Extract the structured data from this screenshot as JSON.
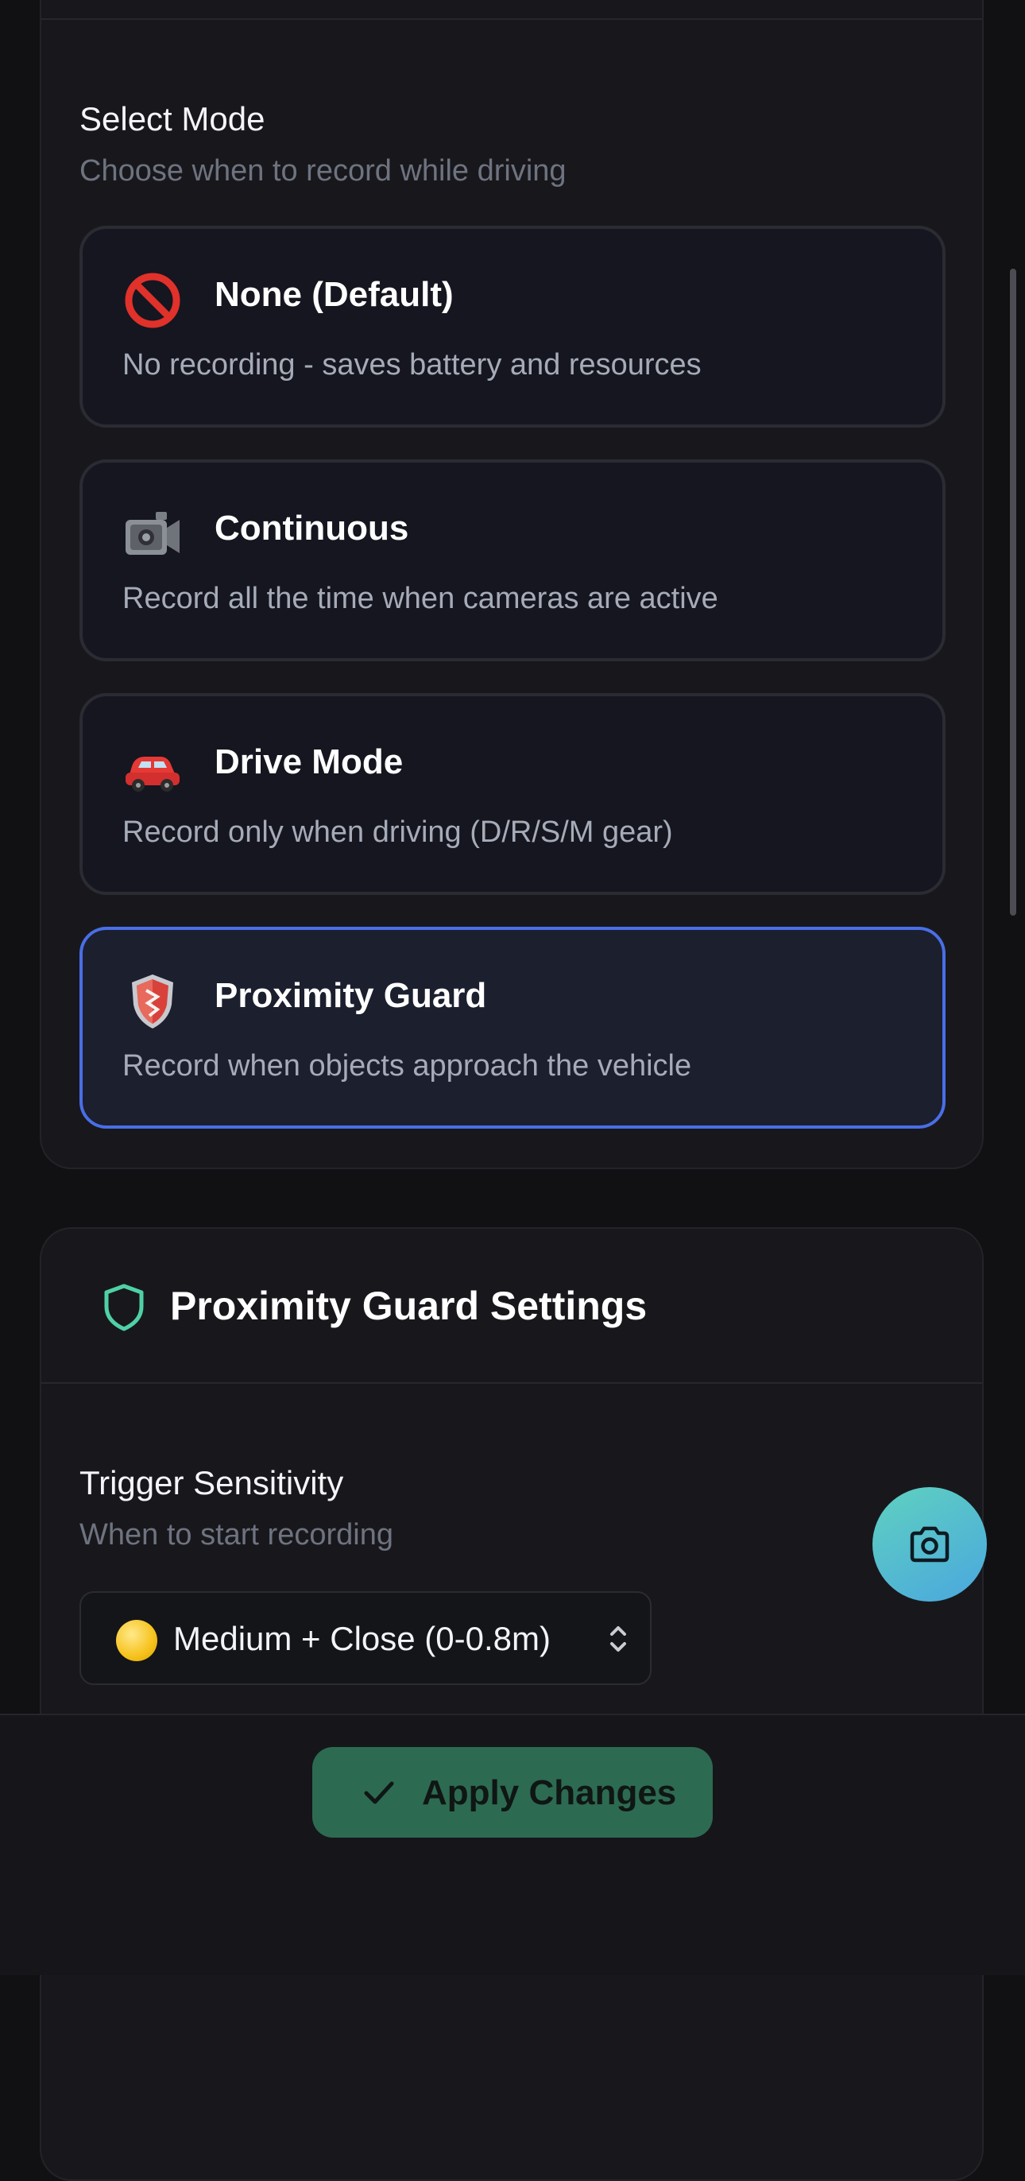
{
  "mode_section": {
    "title": "Select Mode",
    "subtitle": "Choose when to record while driving",
    "options": [
      {
        "title": "None (Default)",
        "description": "No recording - saves battery and resources",
        "icon": "no-entry-icon",
        "selected": false
      },
      {
        "title": "Continuous",
        "description": "Record all the time when cameras are active",
        "icon": "video-camera-icon",
        "selected": false
      },
      {
        "title": "Drive Mode",
        "description": "Record only when driving (D/R/S/M gear)",
        "icon": "car-icon",
        "selected": false
      },
      {
        "title": "Proximity Guard",
        "description": "Record when objects approach the vehicle",
        "icon": "shield-icon",
        "selected": true
      }
    ]
  },
  "guard_section": {
    "title": "Proximity Guard Settings",
    "icon": "shield-outline-icon",
    "accent": "#4fd1a5",
    "sensitivity": {
      "label": "Trigger Sensitivity",
      "hint": "When to start recording",
      "selected_option": "Medium + Close (0-0.8m)"
    }
  },
  "fab": {
    "icon": "camera-icon"
  },
  "footer": {
    "apply_label": "Apply Changes",
    "apply_icon": "check-icon"
  },
  "colors": {
    "selected_border": "#4a6ee6",
    "apply_bg": "#2d6a52",
    "fab_gradient": [
      "#5fd1c0",
      "#4aa7de"
    ]
  }
}
